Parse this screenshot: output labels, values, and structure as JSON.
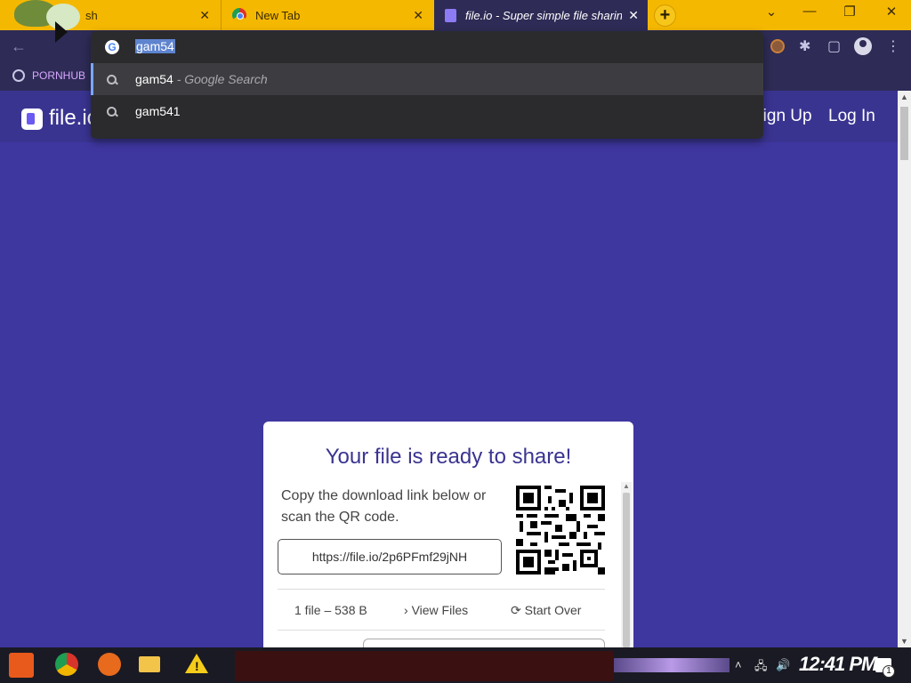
{
  "browser": {
    "tabs": [
      {
        "title": "sh",
        "close": "✕"
      },
      {
        "title": "New Tab",
        "close": "✕"
      },
      {
        "title": "file.io - Super simple file sharing",
        "close": "✕"
      }
    ],
    "new_tab": "+",
    "window_controls": {
      "chevron": "⌄",
      "minimize": "—",
      "restore": "❐",
      "close": "✕"
    },
    "back": "←",
    "bookmark": "PORNHUB"
  },
  "omnibox": {
    "value": "gam54",
    "suggestions": [
      {
        "text": "gam54",
        "suffix": " - Google Search"
      },
      {
        "text": "gam541",
        "suffix": ""
      }
    ]
  },
  "site": {
    "logo": "file.io",
    "signup": "Sign Up",
    "login": "Log In"
  },
  "card": {
    "title": "Your file is ready to share!",
    "description": "Copy the download link below or scan the QR code.",
    "link": "https://file.io/2p6PFmf29jNH",
    "file_info": "1 file – 538 B",
    "view_files": "View Files",
    "start_over": "Start Over"
  },
  "taskbar": {
    "clock": "12:41 PM",
    "notifications": "1"
  },
  "colors": {
    "page_bg": "#3f37a0",
    "accent": "#3a3491",
    "tabstrip": "#f5b800"
  }
}
